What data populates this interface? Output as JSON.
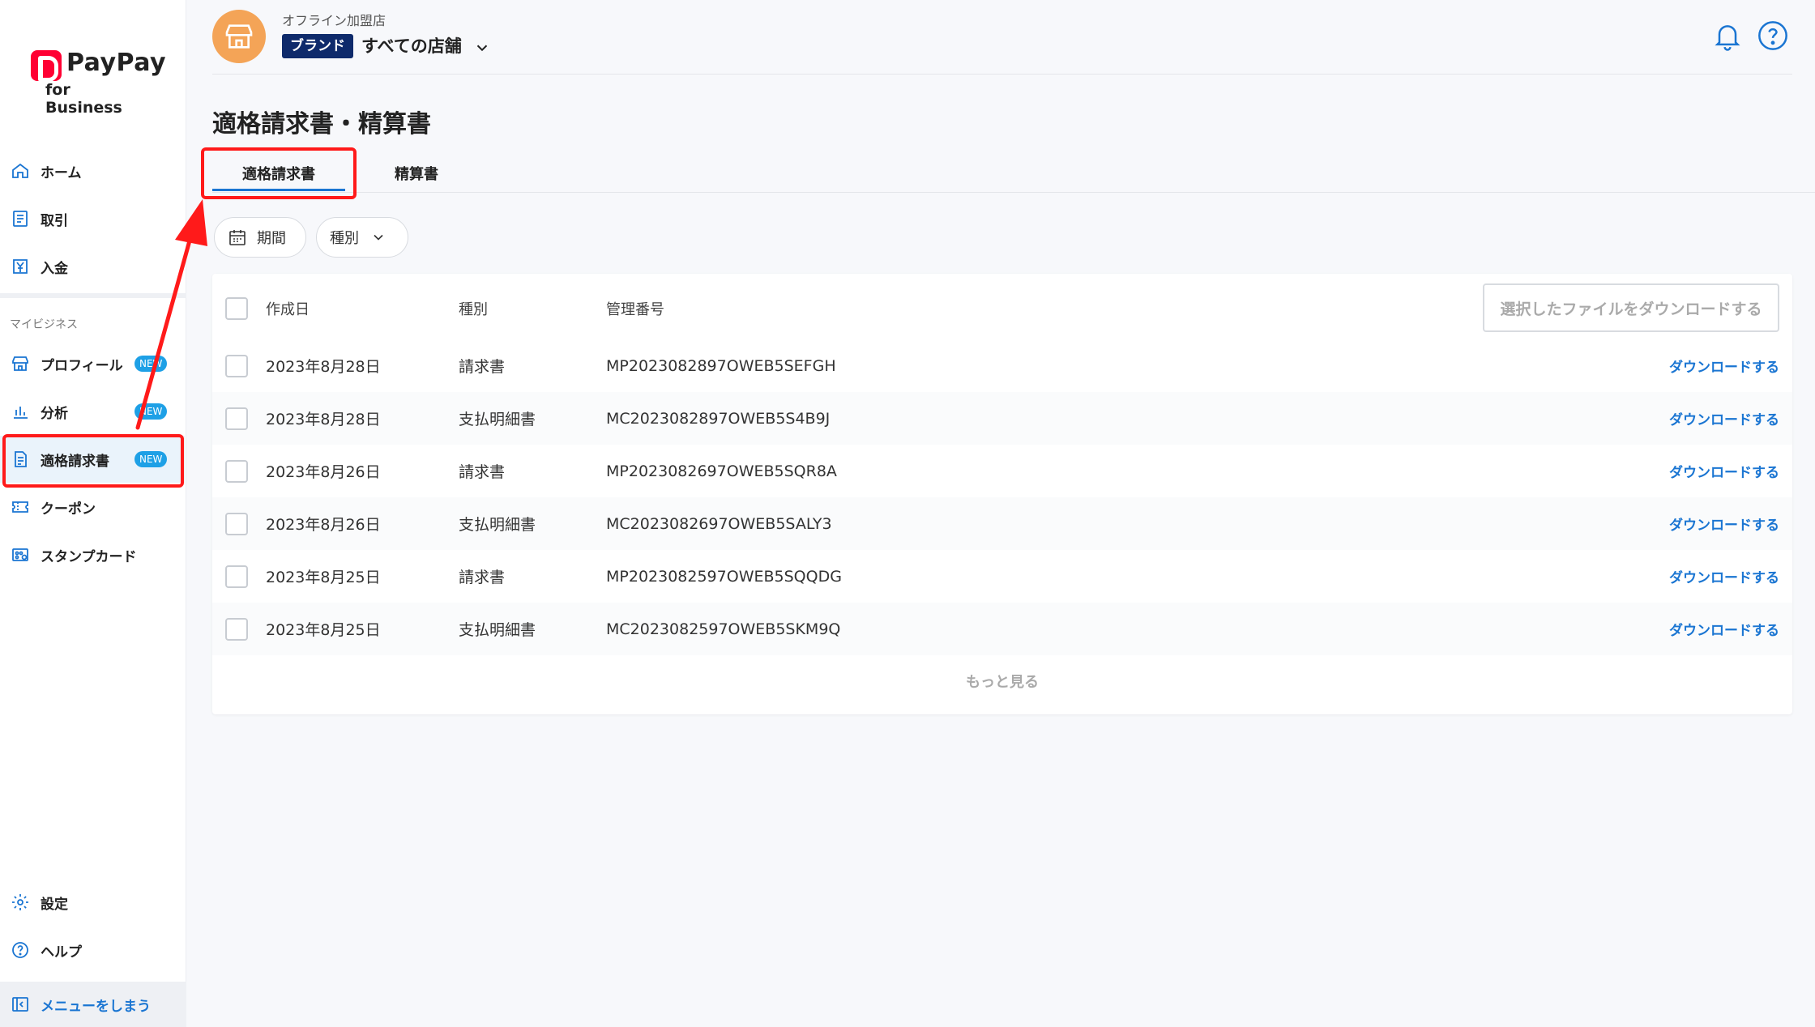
{
  "brand": {
    "logo_word": "PayPay",
    "logo_sub": "for Business"
  },
  "sidebar": {
    "items": [
      {
        "label": "ホーム",
        "icon": "home-icon"
      },
      {
        "label": "取引",
        "icon": "receipt-icon"
      },
      {
        "label": "入金",
        "icon": "deposit-icon"
      }
    ],
    "section_label": "マイビジネス",
    "business_items": [
      {
        "label": "プロフィール",
        "icon": "store-icon",
        "badge": "NEW"
      },
      {
        "label": "分析",
        "icon": "chart-icon",
        "badge": "NEW"
      },
      {
        "label": "適格請求書",
        "icon": "document-icon",
        "badge": "NEW"
      },
      {
        "label": "クーポン",
        "icon": "coupon-icon"
      },
      {
        "label": "スタンプカード",
        "icon": "stamp-card-icon"
      }
    ],
    "bottom_items": [
      {
        "label": "設定",
        "icon": "gear-icon"
      },
      {
        "label": "ヘルプ",
        "icon": "help-icon"
      }
    ],
    "collapse_label": "メニューをしまう"
  },
  "header": {
    "shop_type": "オフライン加盟店",
    "brand_tag": "ブランド",
    "store_name": "すべての店舗"
  },
  "page": {
    "title": "適格請求書・精算書",
    "tabs": [
      {
        "label": "適格請求書",
        "active": true
      },
      {
        "label": "精算書",
        "active": false
      }
    ],
    "filters": {
      "period": "期間",
      "type": "種別"
    }
  },
  "table": {
    "columns": {
      "date": "作成日",
      "type": "種別",
      "id": "管理番号"
    },
    "download_selected": "選択したファイルをダウンロードする",
    "download_label": "ダウンロードする",
    "rows": [
      {
        "date": "2023年8月28日",
        "type": "請求書",
        "id": "MP2023082897OWEB5SEFGH"
      },
      {
        "date": "2023年8月28日",
        "type": "支払明細書",
        "id": "MC2023082897OWEB5S4B9J"
      },
      {
        "date": "2023年8月26日",
        "type": "請求書",
        "id": "MP2023082697OWEB5SQR8A"
      },
      {
        "date": "2023年8月26日",
        "type": "支払明細書",
        "id": "MC2023082697OWEB5SALY3"
      },
      {
        "date": "2023年8月25日",
        "type": "請求書",
        "id": "MP2023082597OWEB5SQQDG"
      },
      {
        "date": "2023年8月25日",
        "type": "支払明細書",
        "id": "MC2023082597OWEB5SKM9Q"
      }
    ],
    "more_label": "もっと見る"
  },
  "colors": {
    "accent": "#1a75d2",
    "badge": "#1ea0e6",
    "brand_tag": "#0e2a6b",
    "annotation": "#ff1a1a",
    "shop_avatar": "#f4a457"
  }
}
